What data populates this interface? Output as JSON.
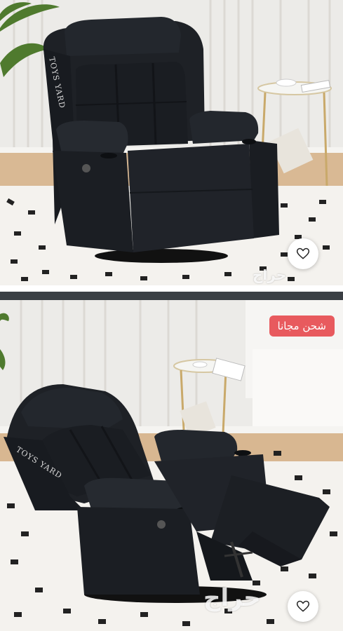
{
  "listing": {
    "images": [
      {
        "alt": ""
      },
      {
        "alt": ""
      }
    ],
    "shipping_badge": "شحن مجانا",
    "brand_text": "TOYS YARD",
    "watermark": "حراج",
    "favorite_icon": "heart-outline-icon"
  },
  "colors": {
    "badge": "#e85a5e",
    "chair": "#1c1f24",
    "wall": "#eceae6",
    "floor": "#d8b892"
  }
}
